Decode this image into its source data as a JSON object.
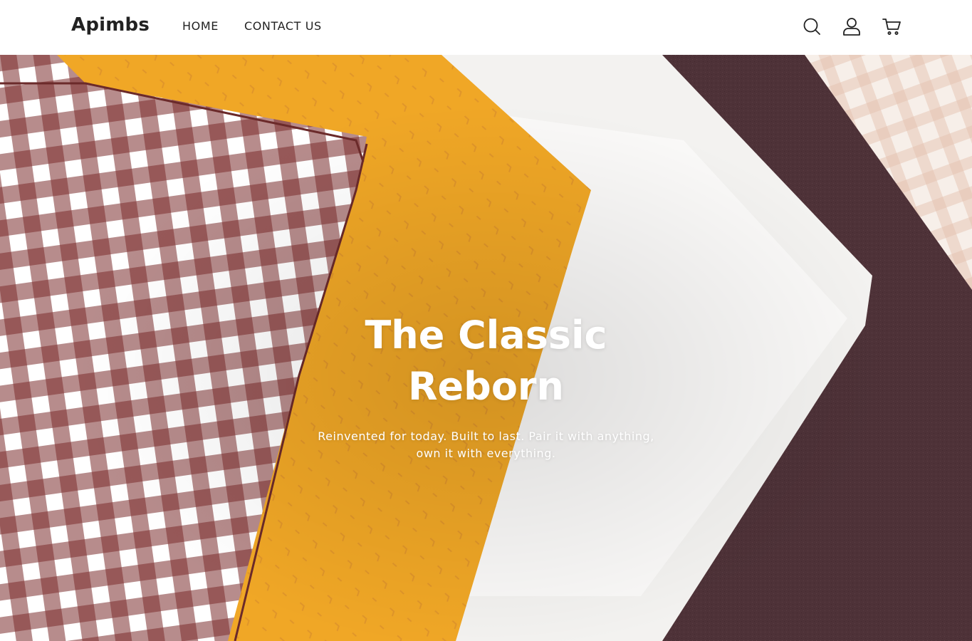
{
  "header": {
    "logo": "Apimbs",
    "nav": [
      {
        "label": "HOME"
      },
      {
        "label": "CONTACT US"
      }
    ],
    "icons": [
      "search-icon",
      "account-icon",
      "cart-icon"
    ]
  },
  "hero": {
    "title": "The Classic Reborn",
    "subtitle": "Reinvented for today. Built to last. Pair it with anything, own it with everything.",
    "colors": {
      "gingham": "#7b2e2e",
      "mustard": "#f0a726",
      "linen": "#f4f3f1",
      "plum": "#4e3238",
      "check": "#f2e4dc"
    }
  }
}
